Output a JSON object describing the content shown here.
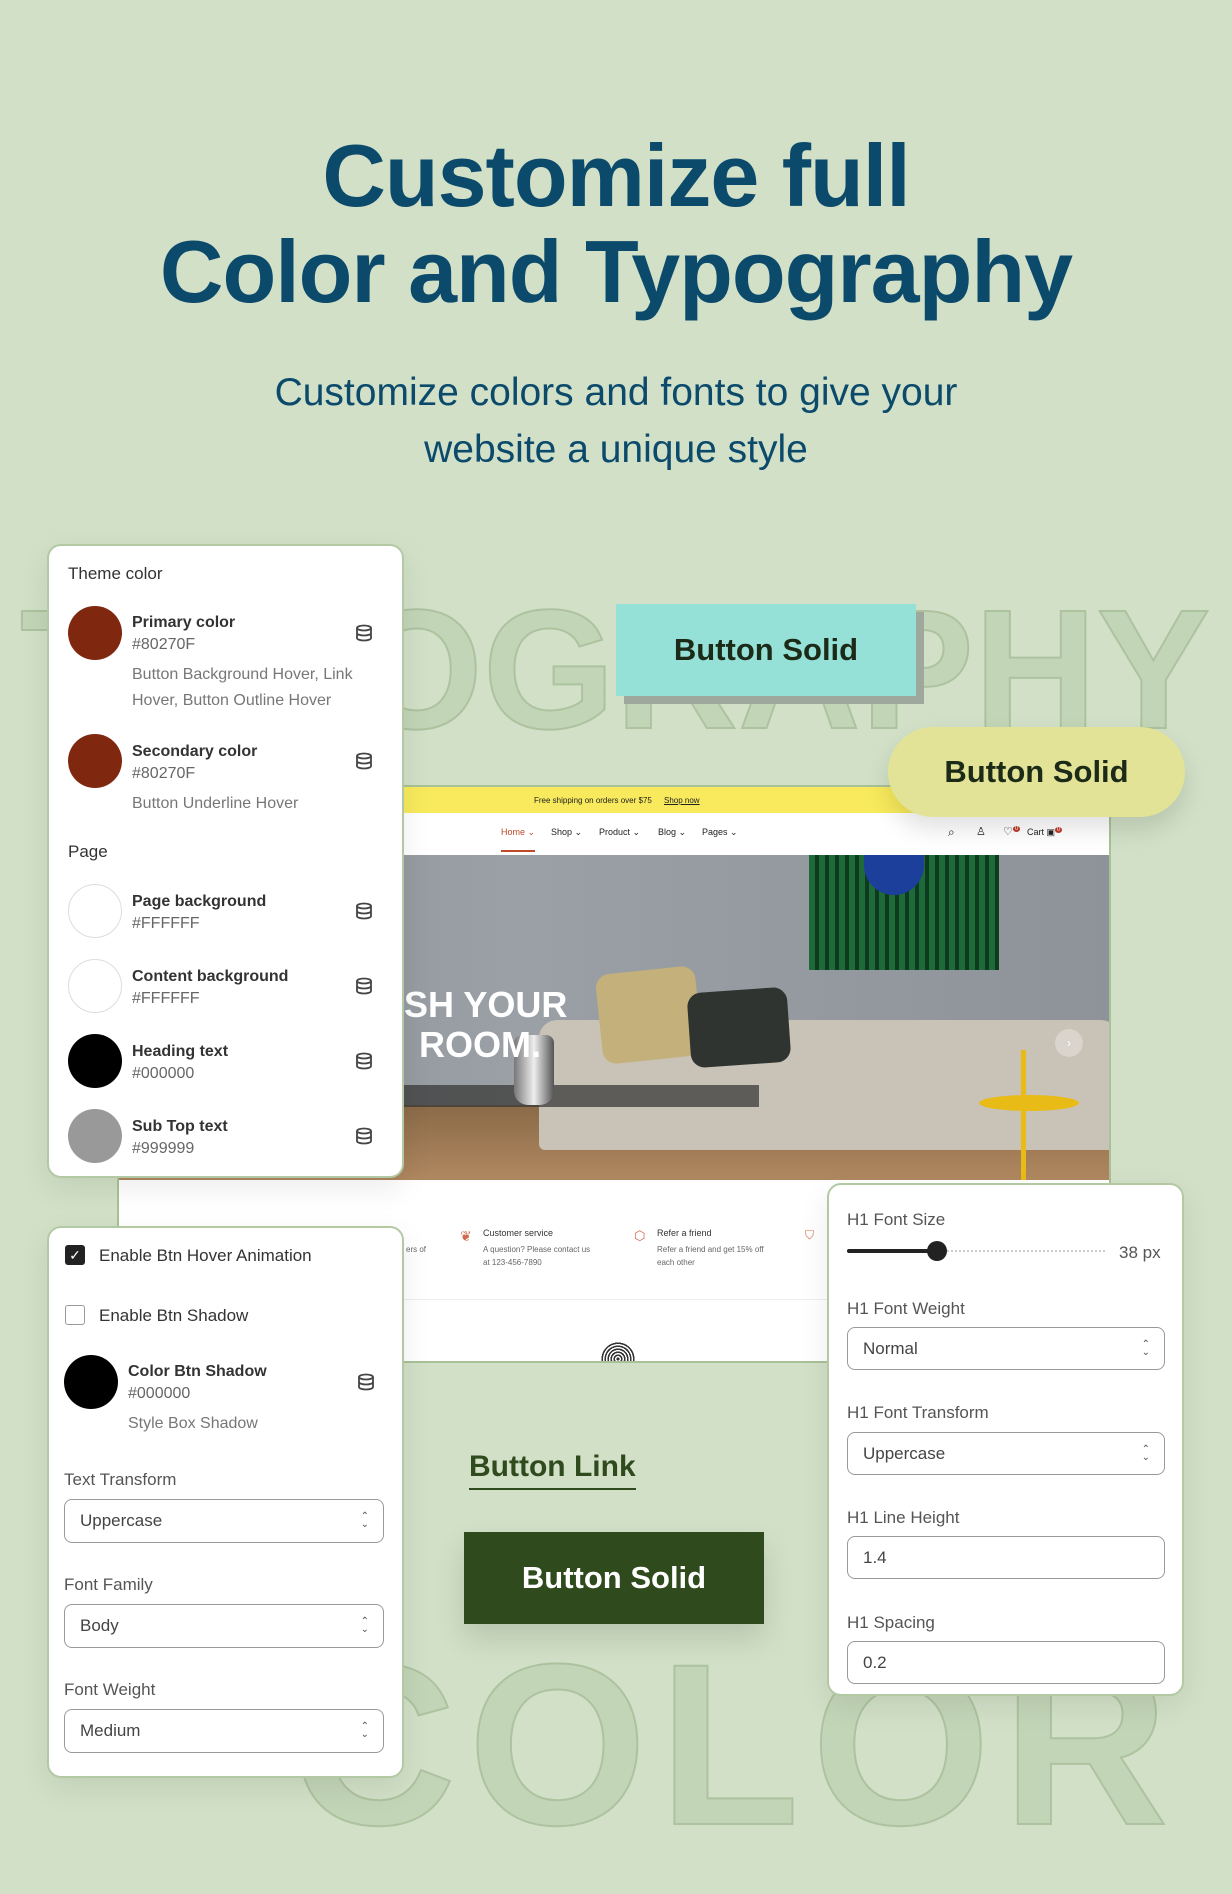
{
  "hero": {
    "title_line1": "Customize full",
    "title_line2": "Color and Typography",
    "subtitle_line1": "Customize colors and fonts to give your",
    "subtitle_line2": "website a unique style",
    "watermark_top": "TYPOGRAPHY",
    "watermark_bottom": "COLOR",
    "title_color": "#0C4A6C",
    "background_color": "#D1E0C7"
  },
  "theme_panel": {
    "section_theme": "Theme color",
    "section_page": "Page",
    "colors": [
      {
        "name": "Primary color",
        "hex": "#80270F",
        "desc_line1": "Button Background Hover, Link",
        "desc_line2": "Hover, Button Outline Hover",
        "swatch": "#80270F",
        "icon": "database-icon"
      },
      {
        "name": "Secondary color",
        "hex": "#80270F",
        "desc_line1": "Button Underline Hover",
        "swatch": "#80270F",
        "icon": "database-icon"
      },
      {
        "name": "Page background",
        "hex": "#FFFFFF",
        "swatch": "#FFFFFF",
        "icon": "database-icon"
      },
      {
        "name": "Content background",
        "hex": "#FFFFFF",
        "swatch": "#FFFFFF",
        "icon": "database-icon"
      },
      {
        "name": "Heading text",
        "hex": "#000000",
        "swatch": "#000000",
        "icon": "database-icon"
      },
      {
        "name": "Sub Top text",
        "hex": "#999999",
        "swatch": "#999999",
        "icon": "database-icon"
      }
    ]
  },
  "button_panel": {
    "hover_animation": {
      "label": "Enable Btn Hover Animation",
      "checked": true
    },
    "shadow": {
      "label": "Enable Btn Shadow",
      "checked": false
    },
    "shadow_color": {
      "name": "Color Btn Shadow",
      "hex": "#000000",
      "desc": "Style Box Shadow",
      "swatch": "#000000"
    },
    "text_transform": {
      "label": "Text Transform",
      "value": "Uppercase"
    },
    "font_family": {
      "label": "Font Family",
      "value": "Body"
    },
    "font_weight": {
      "label": "Font Weight",
      "value": "Medium"
    }
  },
  "h1_panel": {
    "font_size": {
      "label": "H1 Font Size",
      "value_text": "38 px",
      "slider_fraction": 0.35
    },
    "font_weight": {
      "label": "H1 Font Weight",
      "value": "Normal"
    },
    "font_transform": {
      "label": "H1 Font Transform",
      "value": "Uppercase"
    },
    "line_height": {
      "label": "H1 Line Height",
      "value": "1.4"
    },
    "spacing": {
      "label": "H1 Spacing",
      "value": "0.2"
    }
  },
  "buttons": {
    "solid_teal": {
      "label": "Button Solid",
      "color": "#95E0D7"
    },
    "solid_yellow": {
      "label": "Button Solid",
      "color": "#E2E397"
    },
    "link": {
      "label": "Button Link",
      "color": "#2F4A1C"
    },
    "solid_dark": {
      "label": "Button Solid",
      "color": "#2F4A1C"
    }
  },
  "mockup": {
    "announcement": "Free shipping on orders over $75",
    "announcement_link": "Shop now",
    "nav": [
      "Home",
      "Shop",
      "Product",
      "Blog",
      "Pages"
    ],
    "cart_label": "Cart",
    "wishlist_count": "0",
    "cart_count": "0",
    "hero_line1": "SH YOUR",
    "hero_line2": "ROOM.",
    "features": {
      "partial_text": "ers of",
      "items": [
        {
          "title": "Customer service",
          "line1": "A question? Please contact us",
          "line2": "at 123-456-7890",
          "icon": "leaf-icon"
        },
        {
          "title": "Refer a friend",
          "line1": "Refer a friend and get 15% off",
          "line2": "each other",
          "icon": "box-icon"
        }
      ],
      "trailing_icon": "shield-check-icon"
    }
  }
}
